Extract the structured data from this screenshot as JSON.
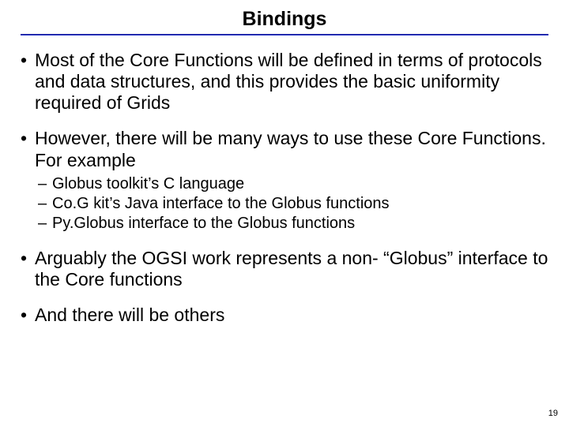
{
  "title": "Bindings",
  "bullets": {
    "b0": "Most of the Core Functions will be defined in terms of protocols and data structures, and this provides the basic uniformity required of Grids",
    "b1": "However, there will be many ways to use these Core Functions. For example",
    "b1_sub": {
      "s0": "Globus toolkit’s C language",
      "s1": "Co.G kit’s Java interface to the Globus functions",
      "s2": "Py.Globus interface to the Globus functions"
    },
    "b2": "Arguably the OGSI work represents a non- “Globus” interface to the Core functions",
    "b3": "And there will be others"
  },
  "page_number": "19"
}
